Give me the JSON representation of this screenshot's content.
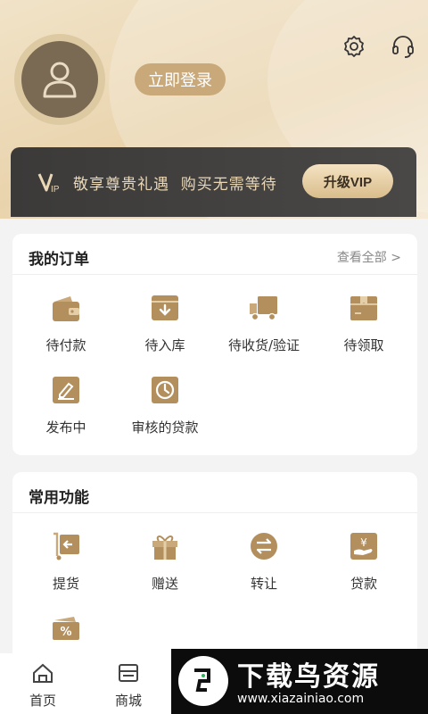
{
  "header": {
    "login_label": "立即登录",
    "icons": {
      "avatar": "user-avatar-icon",
      "settings": "gear-icon",
      "service": "headset-icon"
    }
  },
  "vip": {
    "logo_text": "VIP",
    "slogan": "敬享尊贵礼遇  购买无需等待",
    "upgrade_label": "升级VIP"
  },
  "orders": {
    "title": "我的订单",
    "view_all": "查看全部 >",
    "items": [
      {
        "label": "待付款",
        "icon": "wallet-icon"
      },
      {
        "label": "待入库",
        "icon": "inbox-icon"
      },
      {
        "label": "待收货/验证",
        "icon": "truck-icon"
      },
      {
        "label": "待领取",
        "icon": "package-icon"
      },
      {
        "label": "发布中",
        "icon": "edit-icon"
      },
      {
        "label": "审核的贷款",
        "icon": "clock-icon"
      }
    ]
  },
  "functions": {
    "title": "常用功能",
    "items": [
      {
        "label": "提货",
        "icon": "cart-icon"
      },
      {
        "label": "赠送",
        "icon": "gift-icon"
      },
      {
        "label": "转让",
        "icon": "transfer-icon"
      },
      {
        "label": "贷款",
        "icon": "yen-hand-icon"
      },
      {
        "label": "",
        "icon": "coupon-icon"
      }
    ]
  },
  "bottom_nav": [
    {
      "label": "首页",
      "icon": "home-icon"
    },
    {
      "label": "商城",
      "icon": "shop-icon"
    }
  ],
  "watermark": {
    "title": "下载鸟资源",
    "url": "www.xiazainiao.com"
  },
  "colors": {
    "accent": "#c9a97a",
    "icon_gold": "#b38f5d",
    "vip_bg": "#3b3a39"
  }
}
